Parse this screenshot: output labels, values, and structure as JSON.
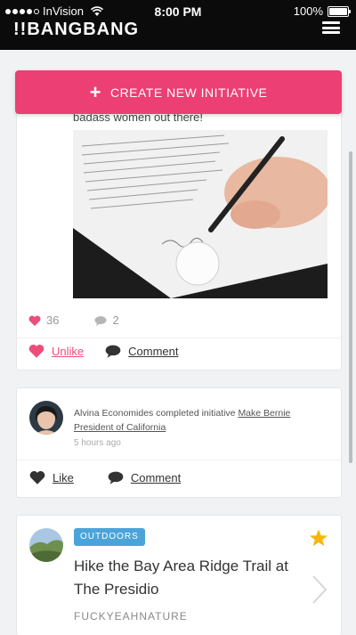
{
  "status_bar": {
    "carrier": "InVision",
    "time": "8:00 PM",
    "battery": "100%",
    "signal_bars": 4,
    "signal_total": 5,
    "battery_level": 1.0
  },
  "header": {
    "logo": "!!BANGBANG",
    "menu_icon": "hamburger-icon"
  },
  "create_button": {
    "icon": "plus-icon",
    "label": "CREATE NEW INITIATIVE"
  },
  "post_card": {
    "snippet": "badass women out there!",
    "image_alt": "hand signing a document",
    "likes": "36",
    "comments": "2",
    "like_action": "Unlike",
    "comment_action": "Comment",
    "colors": {
      "liked": "#ec4d7a"
    }
  },
  "activity_card": {
    "text_prefix": "Alvina Economides completed initiative ",
    "link_text": "Make Bernie President of California",
    "time_ago": "5 hours ago",
    "like_action": "Like",
    "comment_action": "Comment"
  },
  "initiative_card": {
    "tag": "OUTDOORS",
    "title": "Hike the Bay Area Ridge Trail at The Presidio",
    "subtitle": "FUCKYEAHNATURE",
    "icons": [
      "star-icon",
      "chevron-right-icon"
    ],
    "colors": {
      "tag": "#4aa4d9",
      "star": "#f5b70f"
    }
  },
  "colors": {
    "accent": "#ec3f73",
    "header_bg": "#0b0b0b",
    "page_bg": "#f0f2f3"
  }
}
